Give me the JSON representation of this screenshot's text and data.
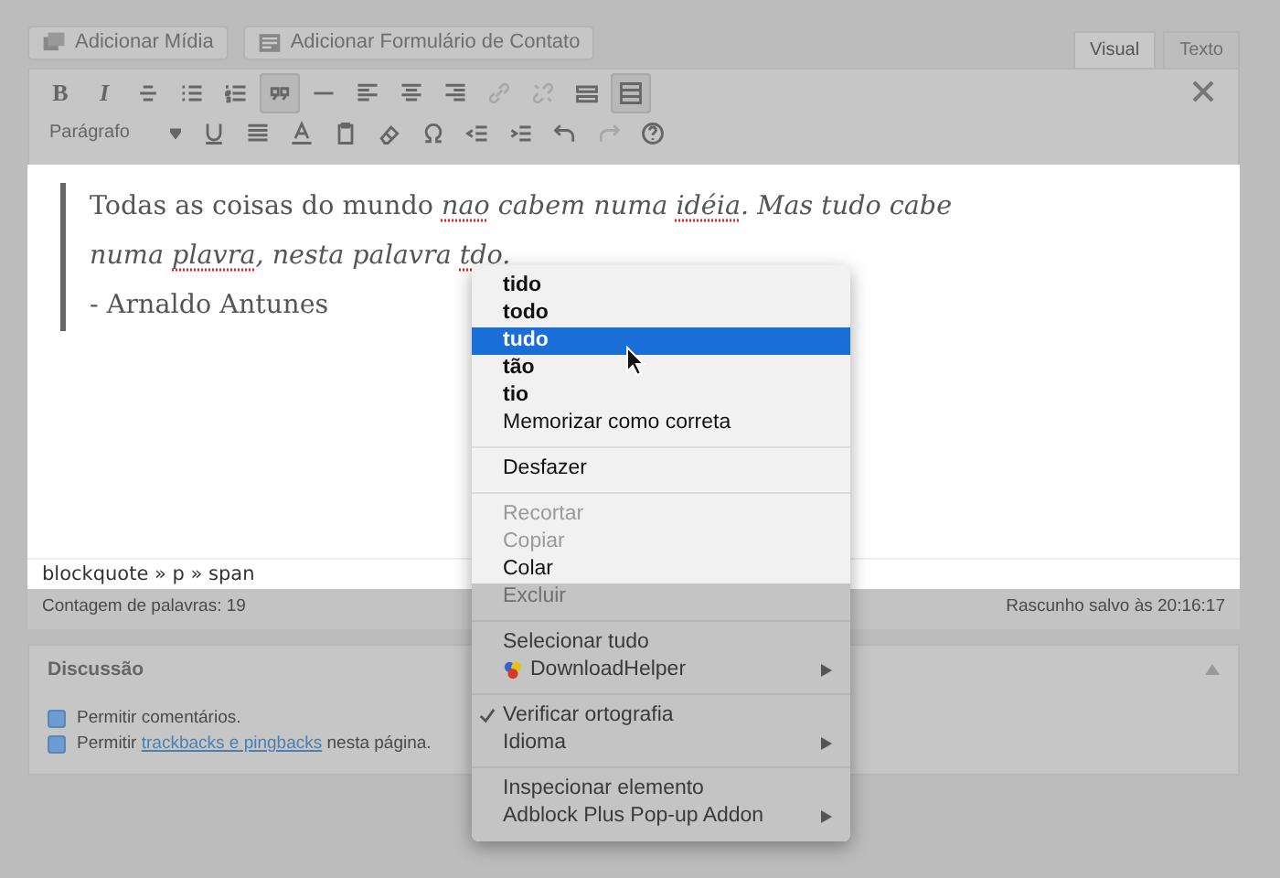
{
  "media_buttons": [
    {
      "kind": "media",
      "label": "Adicionar Mídia"
    },
    {
      "kind": "form",
      "label": "Adicionar Formulário de Contato"
    }
  ],
  "editor_tabs": [
    {
      "label": "Visual",
      "selected": true
    },
    {
      "label": "Texto",
      "selected": false
    }
  ],
  "toolbar": {
    "rows": [
      [
        {
          "kind": "bold",
          "label": "B",
          "active": false,
          "disabled": false
        },
        {
          "kind": "italic",
          "label": "I",
          "active": false,
          "disabled": false
        },
        {
          "kind": "strike",
          "active": false,
          "disabled": false
        },
        {
          "kind": "ul",
          "active": false,
          "disabled": false
        },
        {
          "kind": "ol",
          "active": false,
          "disabled": false
        },
        {
          "kind": "quote",
          "active": true,
          "disabled": false
        },
        {
          "kind": "hr",
          "active": false,
          "disabled": false
        },
        {
          "kind": "left",
          "active": false,
          "disabled": false
        },
        {
          "kind": "center",
          "active": false,
          "disabled": false
        },
        {
          "kind": "right",
          "active": false,
          "disabled": false
        },
        {
          "kind": "link",
          "active": false,
          "disabled": true
        },
        {
          "kind": "unlink",
          "active": false,
          "disabled": true
        },
        {
          "kind": "more",
          "active": false,
          "disabled": false
        },
        {
          "kind": "toggle",
          "active": true,
          "disabled": false
        }
      ],
      [
        {
          "kind": "format",
          "label": "Parágrafo",
          "active": false,
          "disabled": false
        },
        {
          "kind": "underline",
          "active": false,
          "disabled": false
        },
        {
          "kind": "justify",
          "active": false,
          "disabled": false
        },
        {
          "kind": "color",
          "active": false,
          "disabled": false
        },
        {
          "kind": "paste",
          "active": false,
          "disabled": false
        },
        {
          "kind": "clear",
          "active": false,
          "disabled": false
        },
        {
          "kind": "special",
          "active": false,
          "disabled": false
        },
        {
          "kind": "outdent",
          "active": false,
          "disabled": false
        },
        {
          "kind": "indent",
          "active": false,
          "disabled": false
        },
        {
          "kind": "undo",
          "active": false,
          "disabled": false
        },
        {
          "kind": "redo",
          "active": false,
          "disabled": true
        },
        {
          "kind": "help",
          "active": false,
          "disabled": false
        }
      ]
    ]
  },
  "content": {
    "paragraph": [
      {
        "text": "Todas as coisas do mundo ",
        "italic": false,
        "misspelled": false
      },
      {
        "text": "nao",
        "italic": true,
        "misspelled": true
      },
      {
        "text": " cabem numa ",
        "italic": true,
        "misspelled": false
      },
      {
        "text": "idéia",
        "italic": true,
        "misspelled": true
      },
      {
        "text": ". Mas tudo cabe numa ",
        "italic": true,
        "misspelled": false
      },
      {
        "text": "plavra",
        "italic": true,
        "misspelled": true
      },
      {
        "text": ", nesta palavra ",
        "italic": true,
        "misspelled": false
      },
      {
        "text": "tdo",
        "italic": true,
        "misspelled": true
      },
      {
        "text": ".",
        "italic": true,
        "misspelled": false
      }
    ],
    "attribution": "- Arnaldo Antunes"
  },
  "path_bar": "blockquote » p » span",
  "status": {
    "word_count": "Contagem de palavras: 19",
    "draft_status": "Rascunho salvo às 20:16:17"
  },
  "discussion": {
    "title": "Discussão",
    "options": [
      {
        "checked": true,
        "before": "Permitir comentários."
      },
      {
        "checked": true,
        "before": "Permitir ",
        "link": "trackbacks e pingbacks",
        "after": " nesta página."
      }
    ]
  },
  "context_menu": [
    {
      "kind": "suggestion",
      "label": "tido",
      "selected": false,
      "disabled": false,
      "checked": false,
      "submenu": false,
      "blurred": false
    },
    {
      "kind": "suggestion",
      "label": "todo",
      "selected": false,
      "disabled": false,
      "checked": false,
      "submenu": false,
      "blurred": false
    },
    {
      "kind": "suggestion",
      "label": "tudo",
      "selected": true,
      "disabled": false,
      "checked": false,
      "submenu": false,
      "blurred": false
    },
    {
      "kind": "suggestion",
      "label": "tão",
      "selected": false,
      "disabled": false,
      "checked": false,
      "submenu": false,
      "blurred": false
    },
    {
      "kind": "suggestion",
      "label": "tio",
      "selected": false,
      "disabled": false,
      "checked": false,
      "submenu": false,
      "blurred": false
    },
    {
      "kind": "command",
      "label": "Memorizar como correta",
      "selected": false,
      "disabled": false,
      "checked": false,
      "submenu": false,
      "blurred": false
    },
    {
      "kind": "separator",
      "blurred": false
    },
    {
      "kind": "command",
      "label": "Desfazer",
      "selected": false,
      "disabled": false,
      "checked": false,
      "submenu": false,
      "blurred": false
    },
    {
      "kind": "separator",
      "blurred": false
    },
    {
      "kind": "command",
      "label": "Recortar",
      "selected": false,
      "disabled": true,
      "checked": false,
      "submenu": false,
      "blurred": false
    },
    {
      "kind": "command",
      "label": "Copiar",
      "selected": false,
      "disabled": true,
      "checked": false,
      "submenu": false,
      "blurred": false
    },
    {
      "kind": "command",
      "label": "Colar",
      "selected": false,
      "disabled": false,
      "checked": false,
      "submenu": false,
      "blurred": false
    },
    {
      "kind": "command",
      "label": "Excluir",
      "selected": false,
      "disabled": true,
      "checked": false,
      "submenu": false,
      "blurred": true
    },
    {
      "kind": "separator",
      "blurred": true
    },
    {
      "kind": "command",
      "label": "Selecionar tudo",
      "selected": false,
      "disabled": false,
      "checked": false,
      "submenu": false,
      "blurred": true
    },
    {
      "kind": "app",
      "label": "DownloadHelper",
      "selected": false,
      "disabled": false,
      "checked": false,
      "submenu": true,
      "blurred": true
    },
    {
      "kind": "separator",
      "blurred": true
    },
    {
      "kind": "command",
      "label": "Verificar ortografia",
      "selected": false,
      "disabled": false,
      "checked": true,
      "submenu": false,
      "blurred": true
    },
    {
      "kind": "command",
      "label": "Idioma",
      "selected": false,
      "disabled": false,
      "checked": false,
      "submenu": true,
      "blurred": true
    },
    {
      "kind": "separator",
      "blurred": true
    },
    {
      "kind": "command",
      "label": "Inspecionar elemento",
      "selected": false,
      "disabled": false,
      "checked": false,
      "submenu": false,
      "blurred": true
    },
    {
      "kind": "command",
      "label": "Adblock Plus Pop-up Addon",
      "selected": false,
      "disabled": false,
      "checked": false,
      "submenu": true,
      "blurred": true
    }
  ]
}
